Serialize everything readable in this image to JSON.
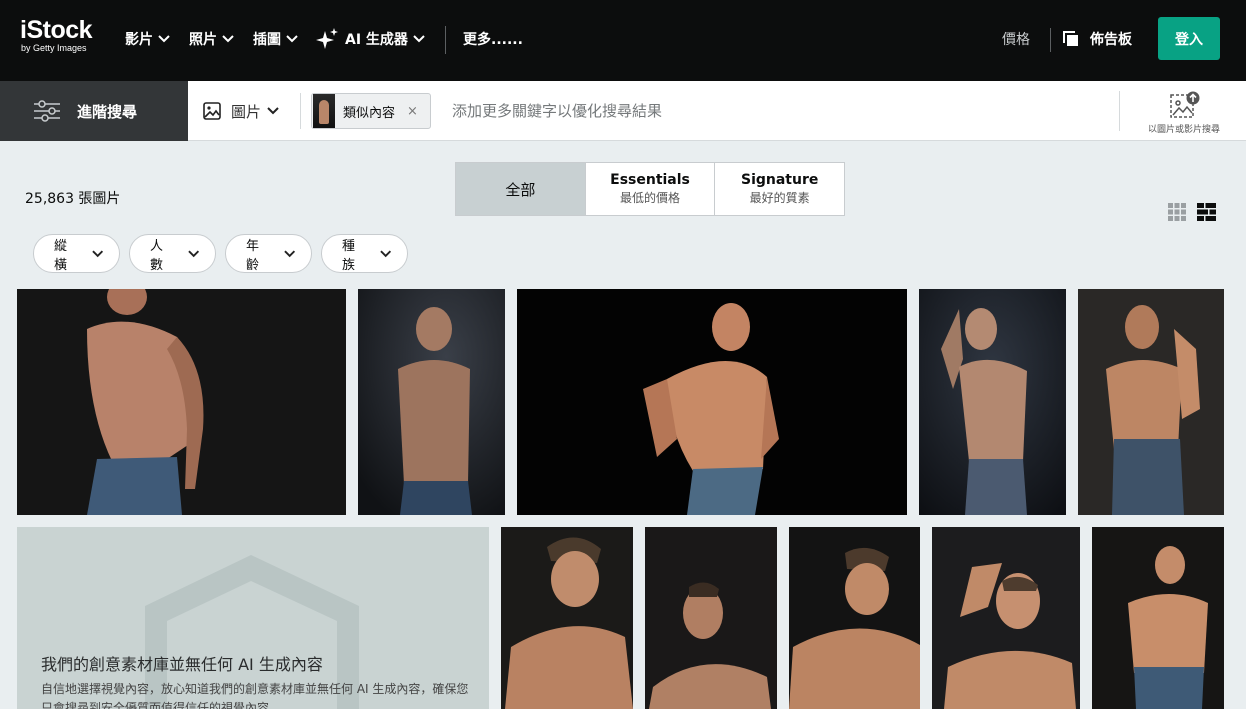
{
  "nav": {
    "logo_main": "iStock",
    "logo_sub": "by Getty Images",
    "videos": "影片",
    "photos": "照片",
    "illustrations": "插圖",
    "ai_generator": "AI 生成器",
    "more": "更多......",
    "pricing": "價格",
    "boards": "佈告板",
    "login": "登入"
  },
  "search": {
    "advanced": "進階搜尋",
    "type": "圖片",
    "chip_label": "類似內容",
    "chip_close": "×",
    "placeholder": "添加更多關鍵字以優化搜尋結果",
    "image_search": "以圖片或影片搜尋"
  },
  "results": {
    "count": "25,863 張圖片",
    "tabs": [
      {
        "title": "全部",
        "sub": ""
      },
      {
        "title": "Essentials",
        "sub": "最低的價格"
      },
      {
        "title": "Signature",
        "sub": "最好的質素"
      }
    ],
    "filters": [
      "縱橫",
      "人數",
      "年齡",
      "種族"
    ]
  },
  "ai_notice": {
    "title": "我們的創意素材庫並無任何 AI 生成內容",
    "body": "自信地選擇視覺內容，放心知道我們的創意素材庫並無任何 AI 生成內容，確保您只會搜尋到安全優質而值得信任的視覺內容。"
  },
  "colors": {
    "nav_bg": "#0c0d0d",
    "accent": "#08a284",
    "page_bg": "#e9eef0",
    "ai_panel": "#c9d3d2"
  }
}
